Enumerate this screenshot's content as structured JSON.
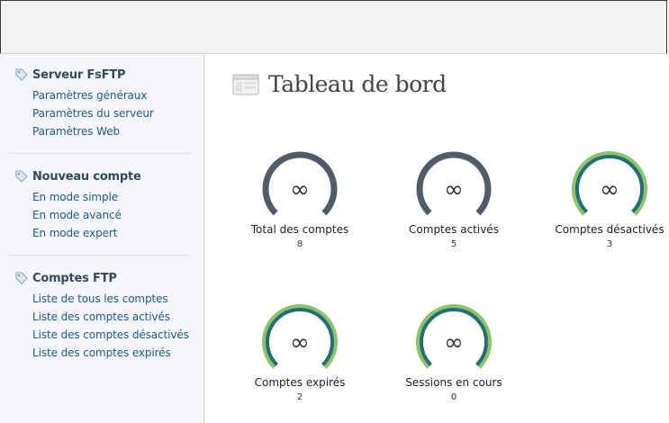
{
  "sidebar": {
    "sections": [
      {
        "title": "Serveur FsFTP",
        "items": [
          "Paramètres généraux",
          "Paramètres du serveur",
          "Paramètres Web"
        ]
      },
      {
        "title": "Nouveau compte",
        "items": [
          "En mode simple",
          "En mode avancé",
          "En mode expert"
        ]
      },
      {
        "title": "Comptes FTP",
        "items": [
          "Liste de tous les comptes",
          "Liste des comptes activés",
          "Liste des comptes désactivés",
          "Liste des comptes expirés"
        ]
      }
    ]
  },
  "main": {
    "title": "Tableau de bord",
    "gauges": [
      {
        "symbol": "∞",
        "label": "Total des comptes",
        "value": "8",
        "style": "dark"
      },
      {
        "symbol": "∞",
        "label": "Comptes activés",
        "value": "5",
        "style": "dark"
      },
      {
        "symbol": "∞",
        "label": "Comptes désactivés",
        "value": "3",
        "style": "green"
      },
      {
        "symbol": "∞",
        "label": "Comptes expirés",
        "value": "2",
        "style": "green"
      },
      {
        "symbol": "∞",
        "label": "Sessions en cours",
        "value": "0",
        "style": "green"
      }
    ]
  },
  "colors": {
    "dark_ring": "#525b68",
    "green_outer": "#8dc26f",
    "teal_inner": "#246f73",
    "link": "#1e5a8c"
  },
  "icons": {
    "section": "tag-icon",
    "page": "window-icon"
  }
}
